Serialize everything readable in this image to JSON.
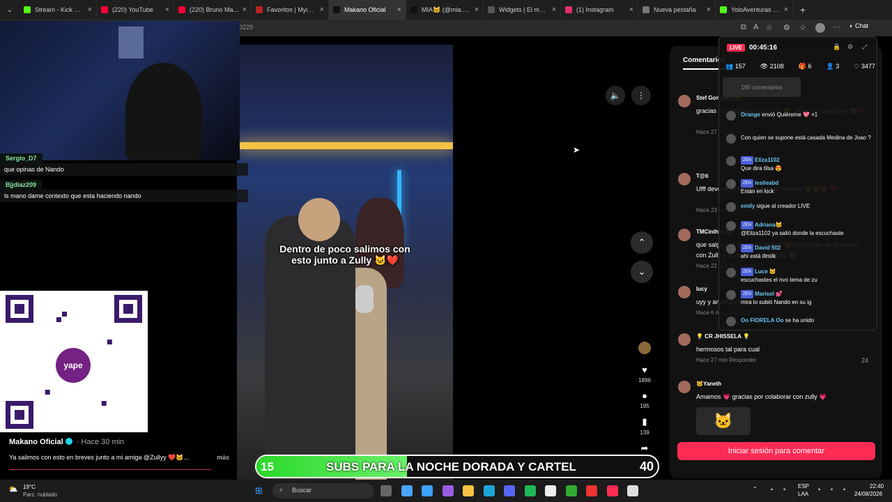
{
  "tabs": [
    {
      "title": "Stream - Kick Dashb",
      "color": "#53fc18"
    },
    {
      "title": "(220) YouTube",
      "color": "#ff0033"
    },
    {
      "title": "(220) Bruno Mars -",
      "color": "#ff0033"
    },
    {
      "title": "Favoritos | Myinstan",
      "color": "#b22"
    },
    {
      "title": "Makano Oficial",
      "color": "#111"
    },
    {
      "title": "MIA🐱 (@mia.3s) | T",
      "color": "#111"
    },
    {
      "title": "Widgets | El mejor s",
      "color": "#555"
    },
    {
      "title": "(1) Instagram",
      "color": "#e1306c"
    },
    {
      "title": "Nueva pestaña",
      "color": "#777"
    },
    {
      "title": "YoloAventuras Strea",
      "color": "#53fc18"
    }
  ],
  "address": {
    "text": "0229",
    "chat_label": "Chat"
  },
  "stream_chat": [
    {
      "user": "Sergio_D7",
      "text": "que opinas de Nando"
    },
    {
      "user": "Bjjdiaz209",
      "text": "ls mano dame contexto que esta haciendo nando"
    }
  ],
  "qr": {
    "logo": "yape"
  },
  "video": {
    "caption": "Dentro de poco salimos con esto junto a Zully 🐱❤️",
    "author": "Makano Oficial",
    "ago": "· Hace 30 min",
    "description": "Ya salimos con esto en breves junto a mi amiga @Zullyy ❤️🐱...",
    "more": "más",
    "likes": "1896",
    "comments": "195",
    "saves": "139",
    "shares": "269"
  },
  "comments_panel": {
    "tab": "Comentarios",
    "login": "Iniciar sesión para comentar",
    "items": [
      {
        "name": "Stef Gonzales 🐱",
        "text": "gracias por colaborar con zully 🐱 . Amo tus canciones 🐱❤️",
        "meta": "Hace 27 min   Responder",
        "likes": "143"
      },
      {
        "name": "T@ti",
        "text": "Ufff devoraron que ganas que salgaaa 🐱🐱🐱 ❤️",
        "meta": "Hace 23 min   Responder",
        "likes": "35"
      },
      {
        "name": "TMCinthia 🐱",
        "text": "que salga ya!! Ya quiero bajear 🐱 con rolitas de la anterior con Zully y la nueva con mi Zully 🐱",
        "meta": "Hace 22 min   Responder",
        "likes": "24"
      },
      {
        "name": "lucy",
        "text": "uyy y amamos todos desde panama",
        "meta": "Hace 6 min   Responder",
        "likes": "0"
      },
      {
        "name": "💡 CR JHISSELA 💡",
        "text": "hermosos tal para cual",
        "meta": "Hace 27 min   Responder",
        "likes": "24"
      },
      {
        "name": "🐱Yaneth",
        "text": "Amamos 💗 gracias por colaborar con zully 💗",
        "meta": "",
        "likes": ""
      }
    ]
  },
  "live_overlay": {
    "live": "LIVE",
    "timer": "00:45:16",
    "stats": [
      "👥 157",
      "👁 2108",
      "🎁 6",
      "👤 3",
      "♡ 3477"
    ],
    "count_btn": "195 comentarios",
    "messages": [
      {
        "user": "Orange",
        "text": "envió Quiéreme 💖 ×1"
      },
      {
        "user": "",
        "text": "Con quien se supone está casada Medina de Joao ?"
      },
      {
        "user": "Eliza1102",
        "text": "Que dira tilsa 😍"
      },
      {
        "user": "leslieabd",
        "text": "Están en kick"
      },
      {
        "user": "emily",
        "text": "sigue al creador LIVE"
      },
      {
        "user": "Adriana🐱",
        "text": "@Eliza1102 ya salió donde la escuchaste"
      },
      {
        "user": "David 502",
        "text": "ahí está illmilk"
      },
      {
        "user": "Luce 🐱",
        "text": "escuchastes el nvo tema de zu"
      },
      {
        "user": "Marisol 💕",
        "text": "mira lo subió Nando en su ig"
      },
      {
        "user": "Oo FIORELA Oo",
        "text": "se ha unido"
      }
    ]
  },
  "banner": {
    "left": "15",
    "text": "SUBS PARA LA NOCHE DORADA Y CARTEL",
    "right": "40",
    "progress": 0.375
  },
  "taskbar": {
    "temp": "19°C",
    "weather": "Parc. nublado",
    "search": "Buscar",
    "lang1": "ESP",
    "lang2": "LAA",
    "time": "22:40",
    "date": "24/08/2026"
  }
}
